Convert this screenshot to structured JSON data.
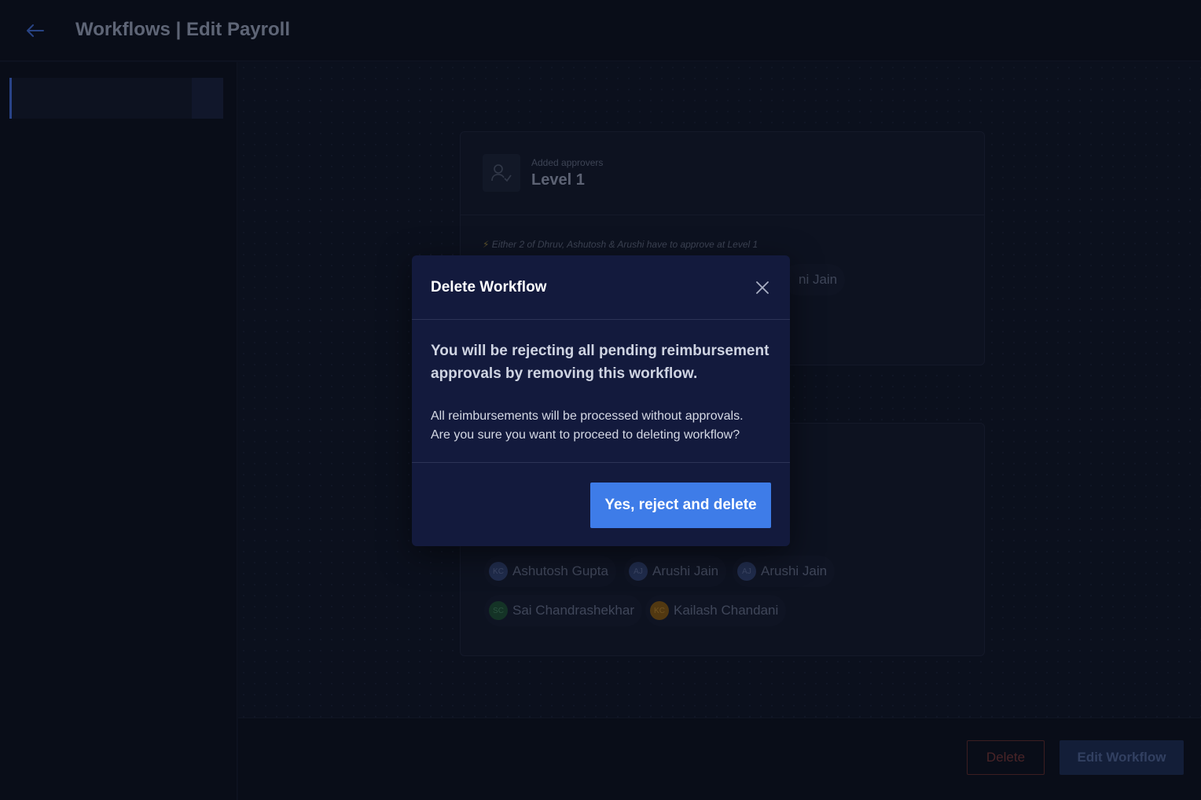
{
  "header": {
    "title": "Workflows | Edit Payroll",
    "back_icon": "arrow-left-icon"
  },
  "levels": [
    {
      "subtitle": "Added approvers",
      "title": "Level 1",
      "note": "Either 2 of Dhruv, Ashutosh & Arushi have to approve at Level 1",
      "approvers_visible": [
        "ni Jain"
      ]
    },
    {
      "approvers": [
        {
          "initials": "KC",
          "name": "Ashutosh Gupta",
          "color": "#3b4a7a"
        },
        {
          "initials": "AJ",
          "name": "Arushi Jain",
          "color": "#3b4a7a"
        },
        {
          "initials": "AJ",
          "name": "Arushi Jain",
          "color": "#3b4a7a"
        },
        {
          "initials": "SC",
          "name": "Sai Chandrashekhar",
          "color": "#1f5a3a"
        },
        {
          "initials": "KC",
          "name": "Kailash Chandani",
          "color": "#8a5a12"
        }
      ]
    }
  ],
  "footer": {
    "delete_label": "Delete",
    "edit_label": "Edit Workflow"
  },
  "modal": {
    "title": "Delete Workflow",
    "lead": "You will be rejecting all pending reimbursement approvals by removing this workflow.",
    "line1": "All reimbursements will be processed without approvals.",
    "line2": "Are you sure you want to proceed to deleting workflow?",
    "confirm_label": "Yes, reject and delete"
  },
  "colors": {
    "accent": "#3e7ce8",
    "modal_bg": "#131a3d",
    "danger": "#6e3434"
  }
}
